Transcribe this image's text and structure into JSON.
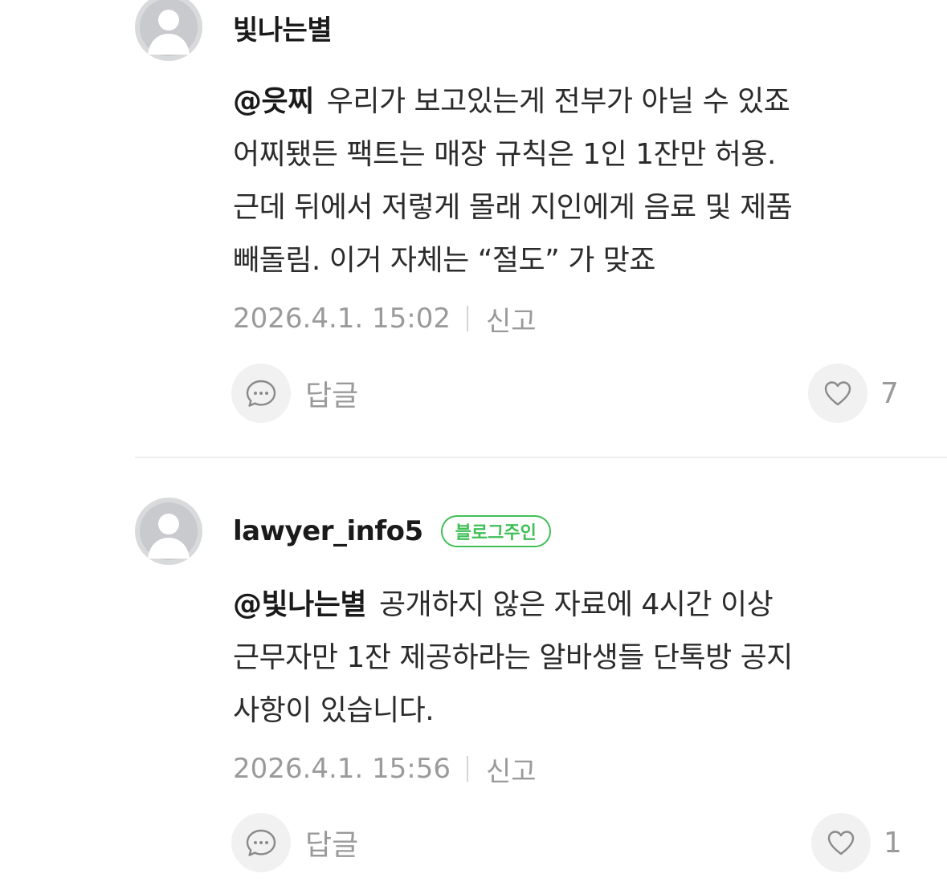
{
  "comments": [
    {
      "nickname": "빛나는별",
      "mention": "@읏찌",
      "text_lines": [
        "우리가 보고있는게 전부가 아닐 수 있죠",
        "어찌됐든 팩트는 매장 규칙은 1인 1잔만 허용.",
        "근데 뒤에서 저렇게 몰래 지인에게 음료 및 제품",
        "빼돌림. 이거 자체는 “절도” 가 맞죠"
      ],
      "timestamp": "2026.4.1. 15:02",
      "report_label": "신고",
      "reply_label": "답글",
      "like_count": "7"
    },
    {
      "nickname": "lawyer_info5",
      "badge": "블로그주인",
      "mention": "@빛나는별",
      "text_lines": [
        "공개하지 않은 자료에 4시간 이상",
        "근무자만 1잔 제공하라는 알바생들 단톡방 공지",
        "사항이 있습니다."
      ],
      "timestamp": "2026.4.1. 15:56",
      "report_label": "신고",
      "reply_label": "답글",
      "like_count": "1"
    }
  ],
  "colors": {
    "badge_green": "#3fbf56",
    "meta_gray": "#9a9a9a",
    "avatar_bg": "#d9dadc"
  },
  "icons": {
    "avatar": "default-profile-icon",
    "reply": "speech-bubble-icon",
    "like": "heart-outline-icon"
  }
}
